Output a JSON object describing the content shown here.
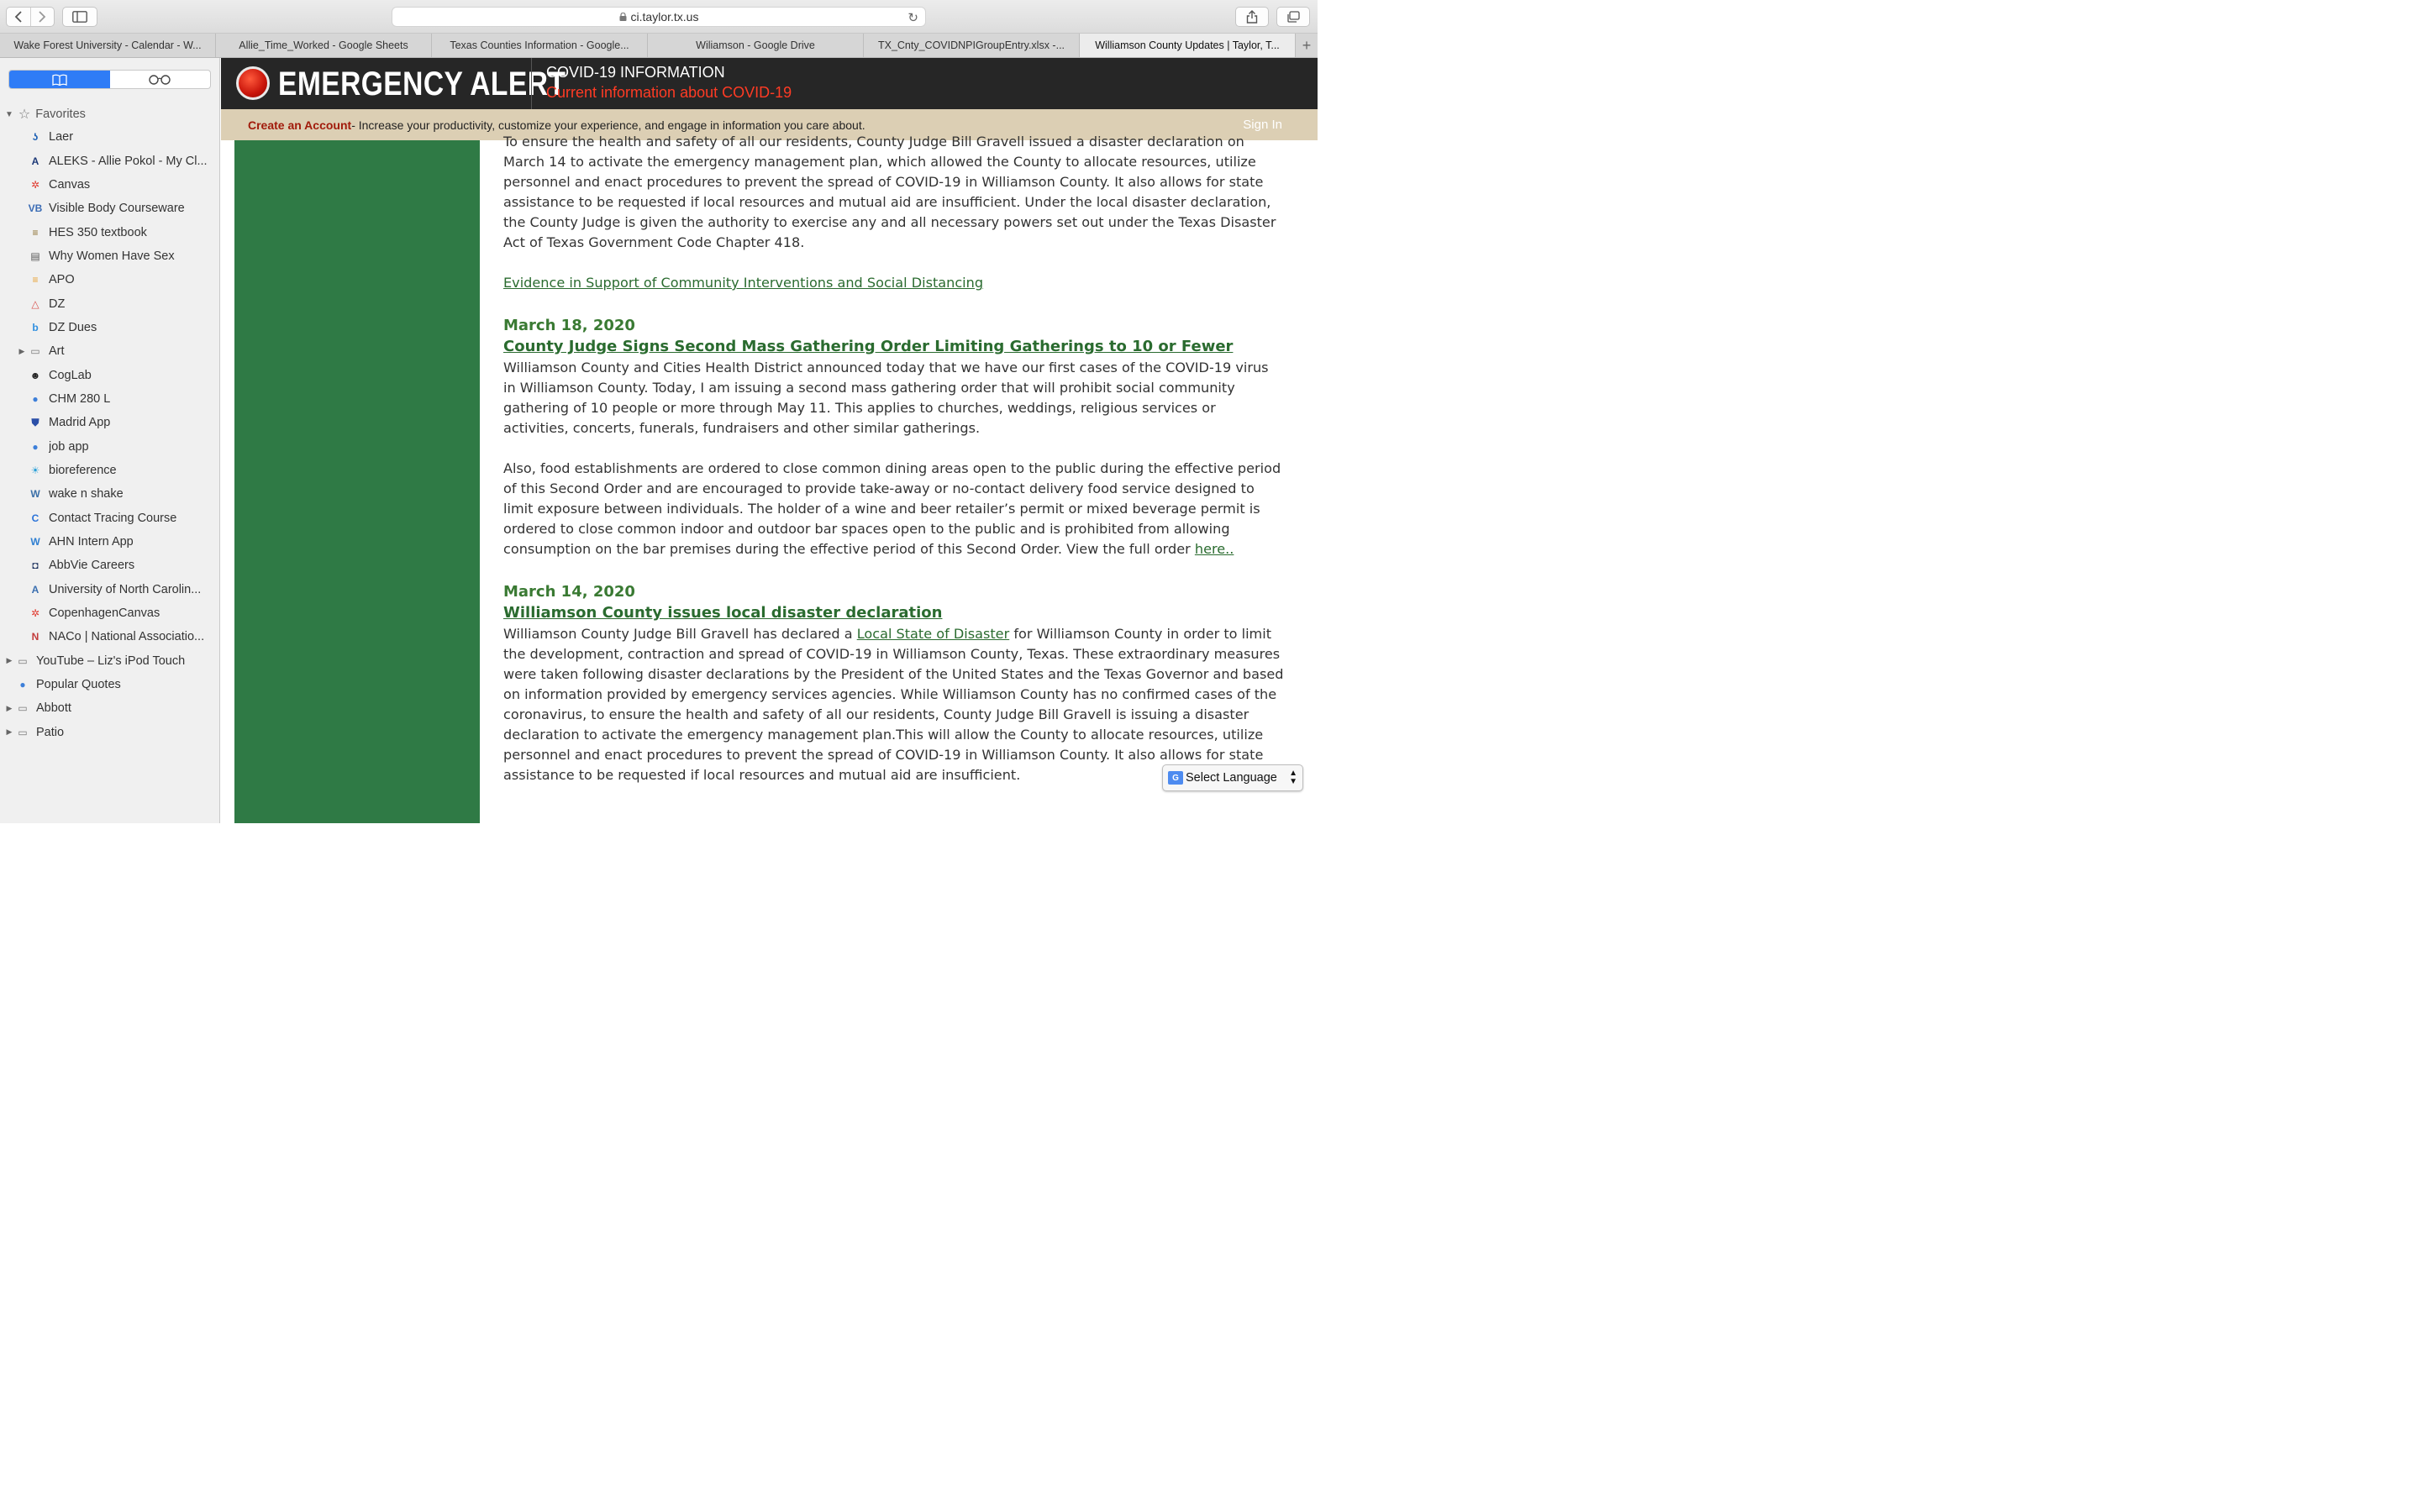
{
  "browser": {
    "url": "ci.taylor.tx.us",
    "tabs": [
      {
        "label": "Wake Forest University - Calendar - W..."
      },
      {
        "label": "Allie_Time_Worked - Google Sheets"
      },
      {
        "label": "Texas Counties Information - Google..."
      },
      {
        "label": "Wiliamson - Google Drive"
      },
      {
        "label": "TX_Cnty_COVIDNPIGroupEntry.xlsx -..."
      },
      {
        "label": "Williamson County Updates | Taylor, T..."
      }
    ],
    "add_tab": "+"
  },
  "sidebar": {
    "favorites_label": "Favorites",
    "items": [
      {
        "label": "Laer",
        "icon": "laer-icon",
        "color": "#1b5fb4",
        "glyph": "ʖ"
      },
      {
        "label": "ALEKS - Allie Pokol - My Cl...",
        "icon": "aleks-icon",
        "color": "#1e3a78",
        "glyph": "A"
      },
      {
        "label": "Canvas",
        "icon": "canvas-icon",
        "color": "#e03a2f",
        "glyph": "✲"
      },
      {
        "label": "Visible Body Courseware",
        "icon": "visible-body-icon",
        "color": "#3b6cb5",
        "glyph": "VB"
      },
      {
        "label": "HES 350 textbook",
        "icon": "book-icon",
        "color": "#8a6d2c",
        "glyph": "≡"
      },
      {
        "label": "Why Women Have Sex",
        "icon": "document-icon",
        "color": "#555555",
        "glyph": "▤"
      },
      {
        "label": "APO",
        "icon": "apo-icon",
        "color": "#e8a030",
        "glyph": "≡"
      },
      {
        "label": "DZ",
        "icon": "dz-icon",
        "color": "#d9534f",
        "glyph": "△"
      },
      {
        "label": "DZ Dues",
        "icon": "dz-dues-icon",
        "color": "#2f8fe0",
        "glyph": "b"
      },
      {
        "label": "Art",
        "icon": "folder-icon",
        "color": "#777777",
        "glyph": "▭"
      },
      {
        "label": "CogLab",
        "icon": "coglab-icon",
        "color": "#222222",
        "glyph": "☻"
      },
      {
        "label": "CHM 280 L",
        "icon": "globe-icon",
        "color": "#3d7fd9",
        "glyph": "●"
      },
      {
        "label": "Madrid App",
        "icon": "shield-icon",
        "color": "#2b4fa8",
        "glyph": "⛊"
      },
      {
        "label": "job app",
        "icon": "globe-icon",
        "color": "#3d7fd9",
        "glyph": "●"
      },
      {
        "label": "bioreference",
        "icon": "bioreference-icon",
        "color": "#2aa0d8",
        "glyph": "☀"
      },
      {
        "label": "wake n shake",
        "icon": "wordpress-icon",
        "color": "#3a6fa8",
        "glyph": "W"
      },
      {
        "label": "Contact Tracing Course",
        "icon": "coursera-icon",
        "color": "#2a73d9",
        "glyph": "C"
      },
      {
        "label": "AHN Intern App",
        "icon": "ahn-icon",
        "color": "#2f7fd1",
        "glyph": "W"
      },
      {
        "label": "AbbVie Careers",
        "icon": "abbvie-icon",
        "color": "#1a2f5c",
        "glyph": "◘"
      },
      {
        "label": "University of North Carolin...",
        "icon": "unc-icon",
        "color": "#3a6fb0",
        "glyph": "A"
      },
      {
        "label": "CopenhagenCanvas",
        "icon": "canvas-icon",
        "color": "#e03a2f",
        "glyph": "✲"
      },
      {
        "label": "NACo | National Associatio...",
        "icon": "naco-icon",
        "color": "#c23b3b",
        "glyph": "N"
      },
      {
        "label": "YouTube – Liz's iPod Touch",
        "icon": "folder-icon",
        "color": "#777777",
        "glyph": "▭"
      },
      {
        "label": "Popular Quotes",
        "icon": "globe-icon",
        "color": "#3d7fd9",
        "glyph": "●"
      },
      {
        "label": "Abbott",
        "icon": "folder-icon",
        "color": "#777777",
        "glyph": "▭"
      },
      {
        "label": "Patio",
        "icon": "folder-icon",
        "color": "#777777",
        "glyph": "▭"
      }
    ]
  },
  "alert": {
    "title": "EMERGENCY ALERT",
    "info_title": "COVID-19 INFORMATION",
    "info_sub": "Current information about COVID-19"
  },
  "account": {
    "create": "Create an Account",
    "text": " - Increase your productivity, customize your experience, and engage in information you care about.",
    "sign_in": "Sign In"
  },
  "content": {
    "intro": "To ensure the health and safety of all our residents, County Judge Bill Gravell issued a disaster declaration on March 14 to activate the emergency management plan, which allowed the County to allocate resources, utilize personnel and enact procedures to prevent the spread of COVID-19 in Williamson County. It also allows for state assistance to be requested if local resources and mutual aid are insufficient. Under the local disaster declaration, the County Judge is given the authority to exercise any and all necessary powers set out under the Texas Disaster Act of Texas Government Code Chapter 418.",
    "evidence_link": "Evidence in Support of Community Interventions and Social Distancing",
    "post1": {
      "date": "March 18, 2020",
      "headline": "County Judge Signs Second Mass Gathering Order Limiting Gatherings to 10 or Fewer",
      "p1": "Williamson County and Cities Health District announced today that we have our first cases of the COVID-19 virus in Williamson County. Today, I am issuing a second mass gathering order that will prohibit social community gathering of 10 people or more through May 11. This applies to churches, weddings, religious services or activities, concerts, funerals, fundraisers and other similar gatherings.",
      "p2": "Also, food establishments are ordered to close common dining areas open to the public during the effective period of this Second Order and are encouraged to provide take-away or no-contact delivery food service designed to limit exposure between individuals. The holder of a wine and beer retailer’s permit or mixed beverage permit is ordered to close common indoor and outdoor bar spaces open to the public and is prohibited from allowing consumption on the bar premises during the effective period of this Second Order. View the full order ",
      "p2_link": "here.."
    },
    "post2": {
      "date": "March 14, 2020",
      "headline": "Williamson County issues local disaster declaration",
      "p1_a": "Williamson County Judge Bill Gravell has declared a ",
      "p1_link": "Local State of Disaster",
      "p1_b": " for Williamson County in order to limit the development, contraction and spread of COVID-19 in Williamson County, Texas. These extraordinary measures were taken following disaster declarations by the President of the United States and the Texas Governor and based on information provided by emergency services agencies. While Williamson County has no confirmed cases of the coronavirus, to ensure the health and safety of all our residents, County Judge Bill Gravell is issuing a disaster declaration to activate the emergency management plan.This will allow the County to allocate resources, utilize personnel and enact procedures to prevent the spread of COVID-19 in Williamson County. It also allows for state assistance to be requested if local resources and mutual aid are insufficient."
    }
  },
  "language": {
    "label": "Select Language",
    "icon": "google-translate-icon"
  }
}
